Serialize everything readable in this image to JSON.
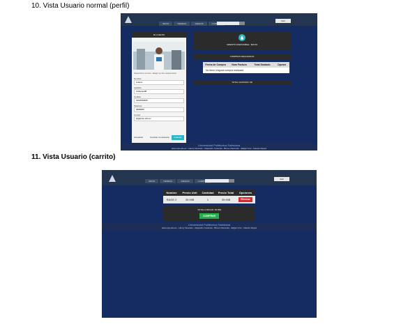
{
  "captions": {
    "first": "10. Vista Usuario normal (perfil)",
    "second": "11. Vista Usuario (carrito)"
  },
  "shot1": {
    "nav": [
      "INICIO",
      "TIENDAS",
      "JUEGOS",
      "CARRITO"
    ],
    "button_right": "Salir",
    "profile_title": "MI CUENTA",
    "profile_note": "Seleccione su foto - Elegir su foto seleccionar",
    "fields": [
      {
        "label": "Nombre",
        "value": "Franco"
      },
      {
        "label": "Apellido",
        "value": "Cabezas08"
      },
      {
        "label": "Cedula",
        "value": "0102030405"
      },
      {
        "label": "Telefono",
        "value": "0999999"
      },
      {
        "label": "Correo",
        "value": "jdg@ups.edu.ec"
      }
    ],
    "link1": "Actualizar",
    "link2": "Cambiar Contraseña",
    "save_button": "Guardar",
    "recharge_text": "CREDITO DISPONIBLE : $20.00",
    "history_title": "COMPRAS REALIZADAS",
    "history_headers": [
      "Fecha de Compra",
      "Num Factura",
      "Total Gastado",
      "Opcion"
    ],
    "history_empty": "No tiene ninguna compra realizada",
    "total_spent": "TOTAL GASTADO: 0$",
    "footer_title": "Universidad Politécnica Salesiana",
    "footer_links": "www.ups.edu.ec - Henry Guaman - Alejandro Cortezas - Bruce Clemente - Edgar Cruz - Darwin Reyes"
  },
  "shot2": {
    "nav": [
      "INICIO",
      "TIENDAS",
      "JUEGOS",
      "CARRITO"
    ],
    "button_right": "Salir",
    "cart_headers": [
      "Nombre",
      "Precio Unit",
      "Cantidad",
      "Precio Total",
      "Opciones"
    ],
    "cart_rows": [
      {
        "nombre": "RAGE 2",
        "precio": "39.99$",
        "cantidad": "1",
        "total": "39.99$",
        "opcion": "Eliminar"
      }
    ],
    "total_label": "TOTAL A PAGAR: 39.99$",
    "buy_button": "COMPRAR",
    "footer_title": "Universidad Politécnica Salesiana",
    "footer_links": "www.ups.edu.ec - Henry Guaman - Alejandro Cortezas - Bruce Clemente - Edgar Cruz - Darwin Reyes"
  },
  "colors": {
    "page_bg": "#ffffff",
    "app_bg": "#1d3a7a",
    "topbar": "#24364f",
    "delete_red": "#e02626",
    "buy_green": "#22b14c",
    "save_teal": "#2eb5c5"
  }
}
